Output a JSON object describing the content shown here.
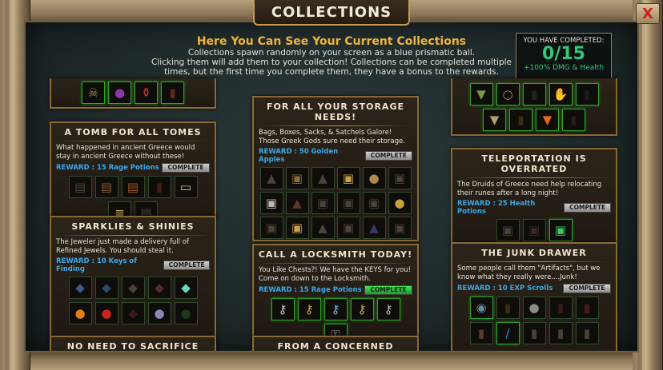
{
  "window": {
    "title": "COLLECTIONS",
    "close_label": "X"
  },
  "header": {
    "title": "Here You Can See Your Current Collections",
    "desc1": "Collections spawn randomly on your screen as a blue prismatic ball.",
    "desc2": "Clicking them will add them to your collection! Collections can be completed multiple",
    "desc3": "times, but the first time you complete them, they have a bonus to the rewards."
  },
  "completed": {
    "label": "YOU HAVE COMPLETED:",
    "value": "0/15",
    "bonus": "+100% DMG & Health"
  },
  "complete_label": "COMPLETE",
  "cards": {
    "tomb": {
      "title": "A TOMB FOR ALL TOMES",
      "desc": "What happened in ancient Greece would stay in ancient Greece without these!",
      "reward": "REWARD : 15 Rage Potions"
    },
    "sparklies": {
      "title": "SPARKLIES & SHINIES",
      "desc": "The Jeweler just made a delivery full of Refined Jewels. You should steal it.",
      "reward": "REWARD : 10 Keys of Finding"
    },
    "sacrifice": {
      "title": "NO NEED TO SACRIFICE"
    },
    "storage": {
      "title": "FOR ALL YOUR STORAGE NEEDS!",
      "desc": "Bags, Boxes, Sacks, & Satchels Galore! Those Greek Gods sure need their storage.",
      "reward": "REWARD : 50 Golden Apples"
    },
    "locksmith": {
      "title": "CALL A LOCKSMITH TODAY!",
      "desc": "You Like Chests?! We have the KEYS for you! Come on down to the Locksmith.",
      "reward": "REWARD : 15 Rage Potions"
    },
    "neighbor": {
      "title": "FROM A CONCERNED NEIGHBOR"
    },
    "teleport": {
      "title": "TELEPORTATION IS OVERRATED",
      "desc": "The Druids of Greece need help relocating their runes after a long night!",
      "reward": "REWARD : 25 Health Potions"
    },
    "junk": {
      "title": "THE JUNK DRAWER",
      "desc": "Some people call them \"Artifacts\", but we know what they really were....Junk!",
      "reward": "REWARD : 10 EXP Scrolls"
    }
  }
}
